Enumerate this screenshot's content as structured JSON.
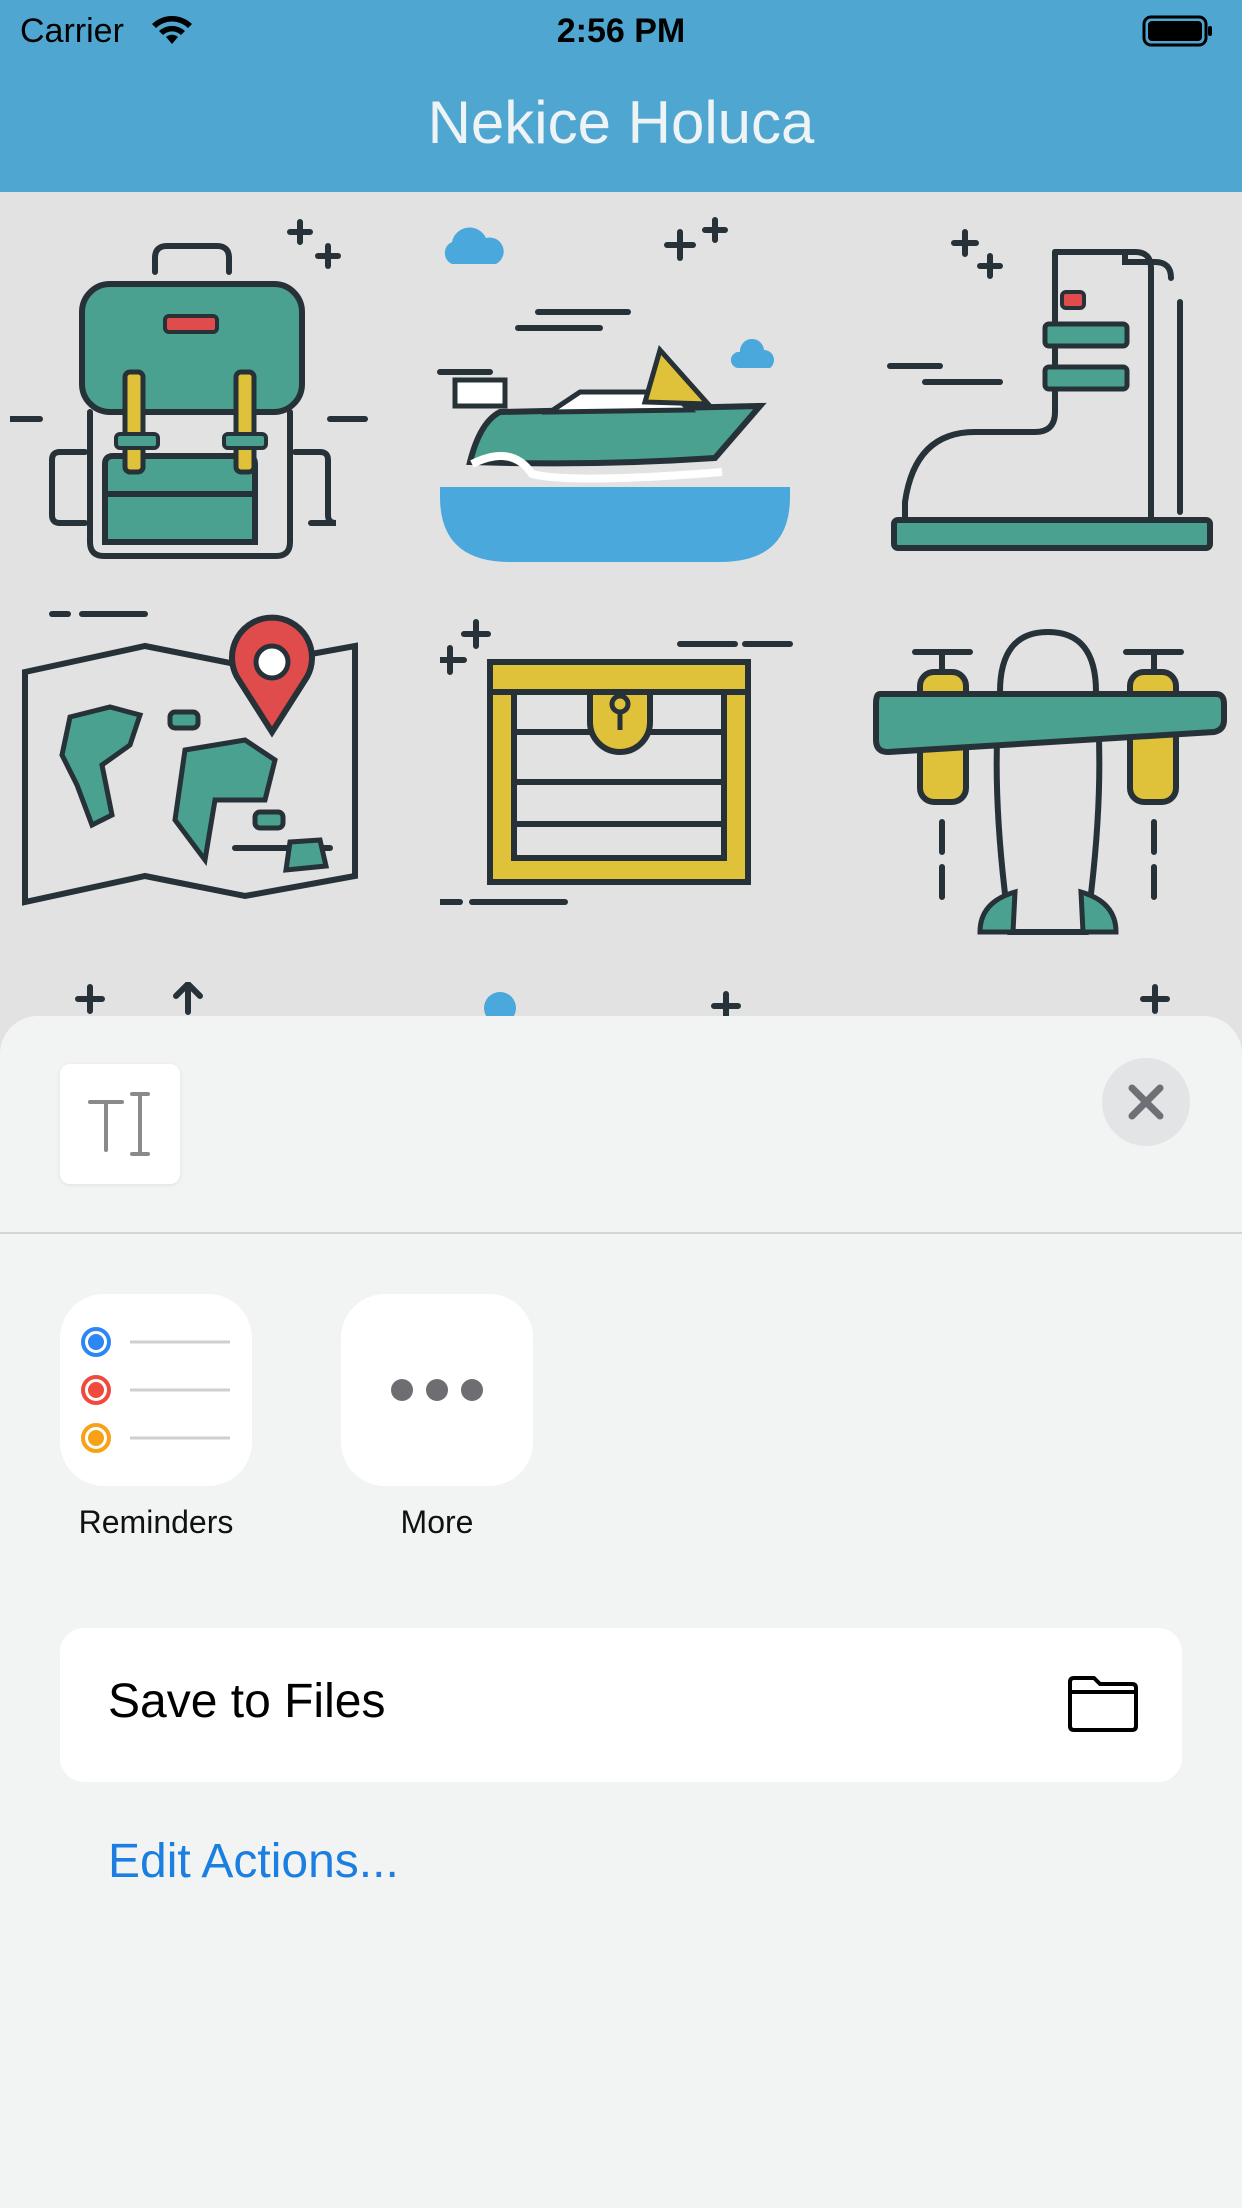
{
  "status_bar": {
    "carrier": "Carrier",
    "time": "2:56 PM"
  },
  "header": {
    "title": "Nekice Holuca"
  },
  "background_icons": [
    "backpack-icon",
    "speedboat-icon",
    "boot-icon",
    "map-pin-icon",
    "treasure-chest-icon",
    "airplane-icon"
  ],
  "share_sheet": {
    "apps": [
      {
        "label": "Reminders",
        "icon": "reminders-icon"
      },
      {
        "label": "More",
        "icon": "more-icon"
      }
    ],
    "actions": [
      {
        "label": "Save to Files",
        "icon": "folder-icon"
      }
    ],
    "edit_actions_label": "Edit Actions..."
  },
  "colors": {
    "header": "#4ea6d1",
    "sheet": "#f2f3f3",
    "link": "#1a7fe0",
    "teal": "#4aa190",
    "yellow": "#e0c13a",
    "red": "#e04b4b",
    "sky": "#4aa8dc"
  }
}
